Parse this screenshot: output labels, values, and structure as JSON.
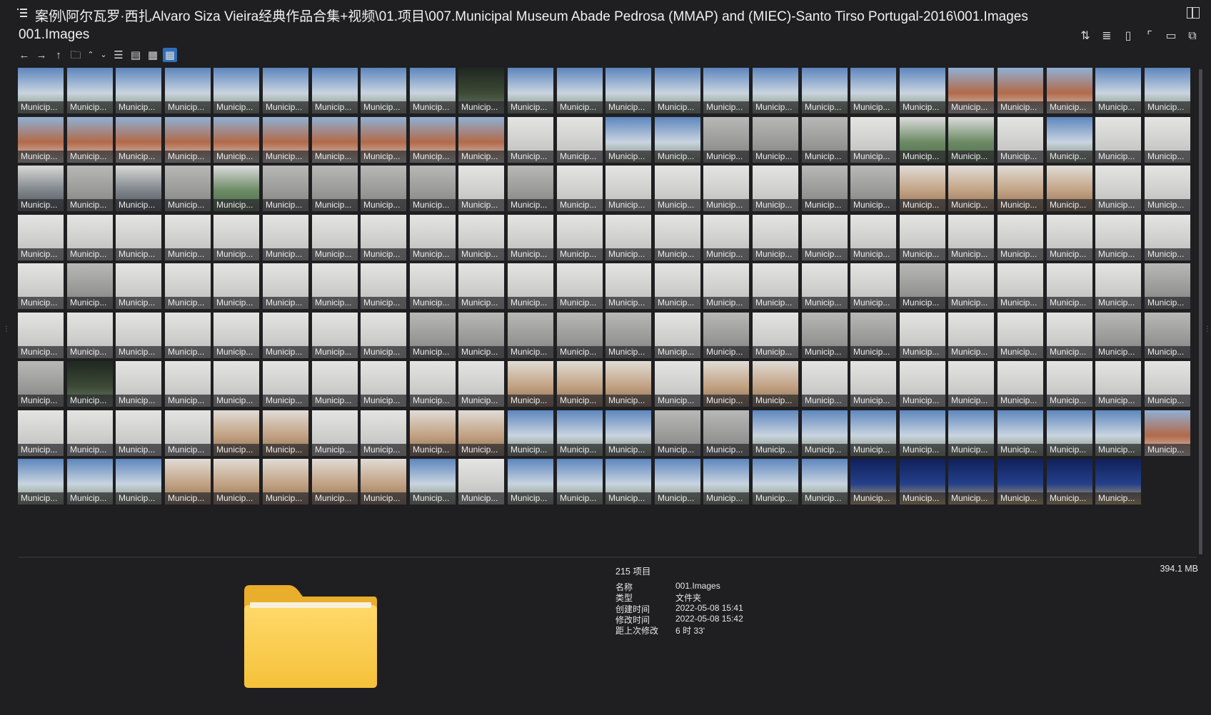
{
  "path_bar": {
    "path": "案例\\阿尔瓦罗·西扎Alvaro Siza Vieira经典作品合集+视频\\01.项目\\007.Municipal Museum Abade Pedrosa (MMAP) and (MIEC)-Santo Tirso  Portugal-2016\\001.Images",
    "menu_icon": "hamburger-icon",
    "pane_icon": "split-pane-icon"
  },
  "folder_title": "001.Images",
  "toolbar": {
    "back_icon": "←",
    "forward_icon": "→",
    "up_icon": "↑",
    "folder_icon": "🗀",
    "sort_up_icon": "⌃",
    "sort_down_icon": "⌄",
    "view_list_icon": "☰",
    "view_details_icon": "▤",
    "view_tiles_icon": "▦",
    "view_thumbs_icon": "▩"
  },
  "right_tools": [
    "⇅",
    "≣",
    "▯",
    "⌜",
    "▭",
    "⧉"
  ],
  "thumbnail_label": "Municip...",
  "thumbnails": [
    "sky",
    "sky",
    "sky",
    "sky",
    "sky",
    "sky",
    "sky",
    "sky",
    "sky",
    "dark",
    "sky",
    "sky",
    "sky",
    "sky",
    "sky",
    "sky",
    "sky",
    "sky",
    "sky",
    "roof",
    "roof",
    "roof",
    "sky",
    "sky",
    "roof",
    "roof",
    "roof",
    "roof",
    "roof",
    "roof",
    "roof",
    "roof",
    "roof",
    "roof",
    "white",
    "white",
    "sky",
    "sky",
    "grey",
    "grey",
    "grey",
    "white",
    "green",
    "green",
    "white",
    "sky",
    "white",
    "white",
    "interior",
    "grey",
    "interior",
    "grey",
    "green",
    "grey",
    "grey",
    "grey",
    "grey",
    "white",
    "grey",
    "white",
    "white",
    "white",
    "white",
    "white",
    "grey",
    "grey",
    "wood",
    "wood",
    "wood",
    "wood",
    "white",
    "white",
    "white",
    "white",
    "white",
    "white",
    "white",
    "white",
    "white",
    "white",
    "white",
    "white",
    "white",
    "white",
    "white",
    "white",
    "white",
    "white",
    "white",
    "white",
    "white",
    "white",
    "white",
    "white",
    "white",
    "white",
    "white",
    "grey",
    "white",
    "white",
    "white",
    "white",
    "white",
    "white",
    "white",
    "white",
    "white",
    "white",
    "white",
    "white",
    "white",
    "white",
    "white",
    "white",
    "grey",
    "white",
    "white",
    "white",
    "white",
    "grey",
    "white",
    "white",
    "white",
    "white",
    "white",
    "white",
    "white",
    "white",
    "grey",
    "grey",
    "grey",
    "grey",
    "grey",
    "white",
    "grey",
    "white",
    "grey",
    "grey",
    "white",
    "white",
    "white",
    "white",
    "grey",
    "grey",
    "grey",
    "dark",
    "white",
    "white",
    "white",
    "white",
    "white",
    "white",
    "white",
    "white",
    "wood",
    "wood",
    "wood",
    "white",
    "wood",
    "wood",
    "white",
    "white",
    "white",
    "white",
    "white",
    "white",
    "white",
    "white",
    "white",
    "white",
    "white",
    "white",
    "wood",
    "wood",
    "white",
    "white",
    "wood",
    "wood",
    "sky",
    "sky",
    "sky",
    "grey",
    "grey",
    "sky",
    "sky",
    "sky",
    "sky",
    "sky",
    "sky",
    "sky",
    "sky",
    "roof",
    "sky",
    "sky",
    "sky",
    "wood",
    "wood",
    "wood",
    "wood",
    "wood",
    "sky",
    "white",
    "sky",
    "sky",
    "sky",
    "sky",
    "sky",
    "sky",
    "sky",
    "night",
    "night",
    "night",
    "night",
    "night",
    "night"
  ],
  "colors": {
    "sky": "#6d8fb8",
    "roof": "#a56a4f",
    "dark": "#2a2e2a",
    "white": "#d6d6d4",
    "grey": "#a5a5a3",
    "green": "#6f8a6a",
    "interior": "#8e949a",
    "wood": "#b39a80",
    "night": "#233a78",
    "background": "#1f1f22",
    "accent": "#2f6fb8",
    "folder": "#f4c542"
  },
  "details": {
    "item_count": "215 项目",
    "total_size": "394.1 MB",
    "folder_icon": "folder-icon",
    "rows": [
      {
        "key": "名称",
        "value": "001.Images"
      },
      {
        "key": "类型",
        "value": "文件夹"
      },
      {
        "key": "创建时间",
        "value": "2022-05-08  15:41"
      },
      {
        "key": "修改时间",
        "value": "2022-05-08  15:42"
      },
      {
        "key": "距上次修改",
        "value": "6 时 33'"
      }
    ]
  }
}
